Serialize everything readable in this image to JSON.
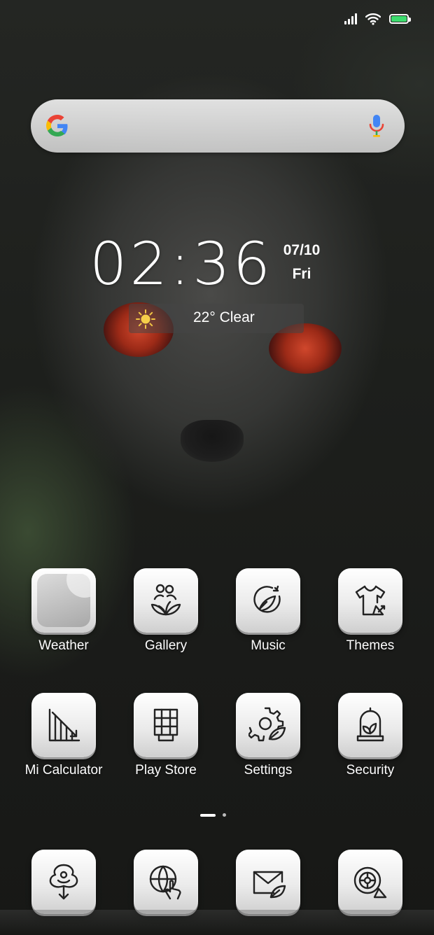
{
  "status_bar": {
    "signal_icon": "signal-bars-icon",
    "wifi_icon": "wifi-icon",
    "battery_icon": "battery-icon",
    "battery_color": "#3ddc6e",
    "battery_level": 0.95
  },
  "search": {
    "logo": "google-g-logo",
    "mic_icon": "microphone-icon"
  },
  "clock_widget": {
    "time": "02:36",
    "date": "07/10",
    "day": "Fri",
    "weather": "22° Clear",
    "weather_icon": "sun-icon"
  },
  "apps_row1": [
    {
      "label": "Weather",
      "icon": "weather-icon"
    },
    {
      "label": "Gallery",
      "icon": "gallery-icon"
    },
    {
      "label": "Music",
      "icon": "music-icon"
    },
    {
      "label": "Themes",
      "icon": "themes-icon"
    }
  ],
  "apps_row2": [
    {
      "label": "Mi Calculator",
      "icon": "calculator-icon"
    },
    {
      "label": "Play Store",
      "icon": "play-store-icon"
    },
    {
      "label": "Settings",
      "icon": "settings-icon"
    },
    {
      "label": "Security",
      "icon": "security-icon"
    }
  ],
  "dock": [
    {
      "icon": "phone-icon"
    },
    {
      "icon": "browser-icon"
    },
    {
      "icon": "messages-icon"
    },
    {
      "icon": "camera-icon"
    }
  ],
  "pager": {
    "pages": 2,
    "active": 1
  }
}
